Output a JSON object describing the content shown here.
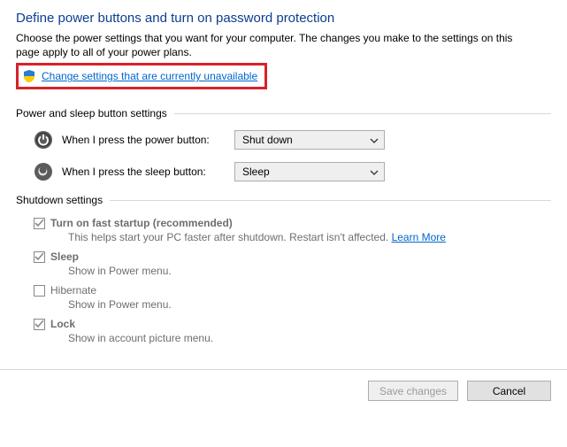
{
  "title": "Define power buttons and turn on password protection",
  "intro": "Choose the power settings that you want for your computer. The changes you make to the settings on this page apply to all of your power plans.",
  "change_link": "Change settings that are currently unavailable",
  "section_buttons": "Power and sleep button settings",
  "power_row": {
    "label": "When I press the power button:",
    "value": "Shut down"
  },
  "sleep_row": {
    "label": "When I press the sleep button:",
    "value": "Sleep"
  },
  "section_shutdown": "Shutdown settings",
  "opts": {
    "fast": {
      "label": "Turn on fast startup (recommended)",
      "desc_a": "This helps start your PC faster after shutdown. Restart isn't affected. ",
      "learn": "Learn More",
      "checked": true
    },
    "sleep": {
      "label": "Sleep",
      "desc": "Show in Power menu.",
      "checked": true
    },
    "hib": {
      "label": "Hibernate",
      "desc": "Show in Power menu.",
      "checked": false
    },
    "lock": {
      "label": "Lock",
      "desc": "Show in account picture menu.",
      "checked": true
    }
  },
  "buttons": {
    "save": "Save changes",
    "cancel": "Cancel"
  }
}
